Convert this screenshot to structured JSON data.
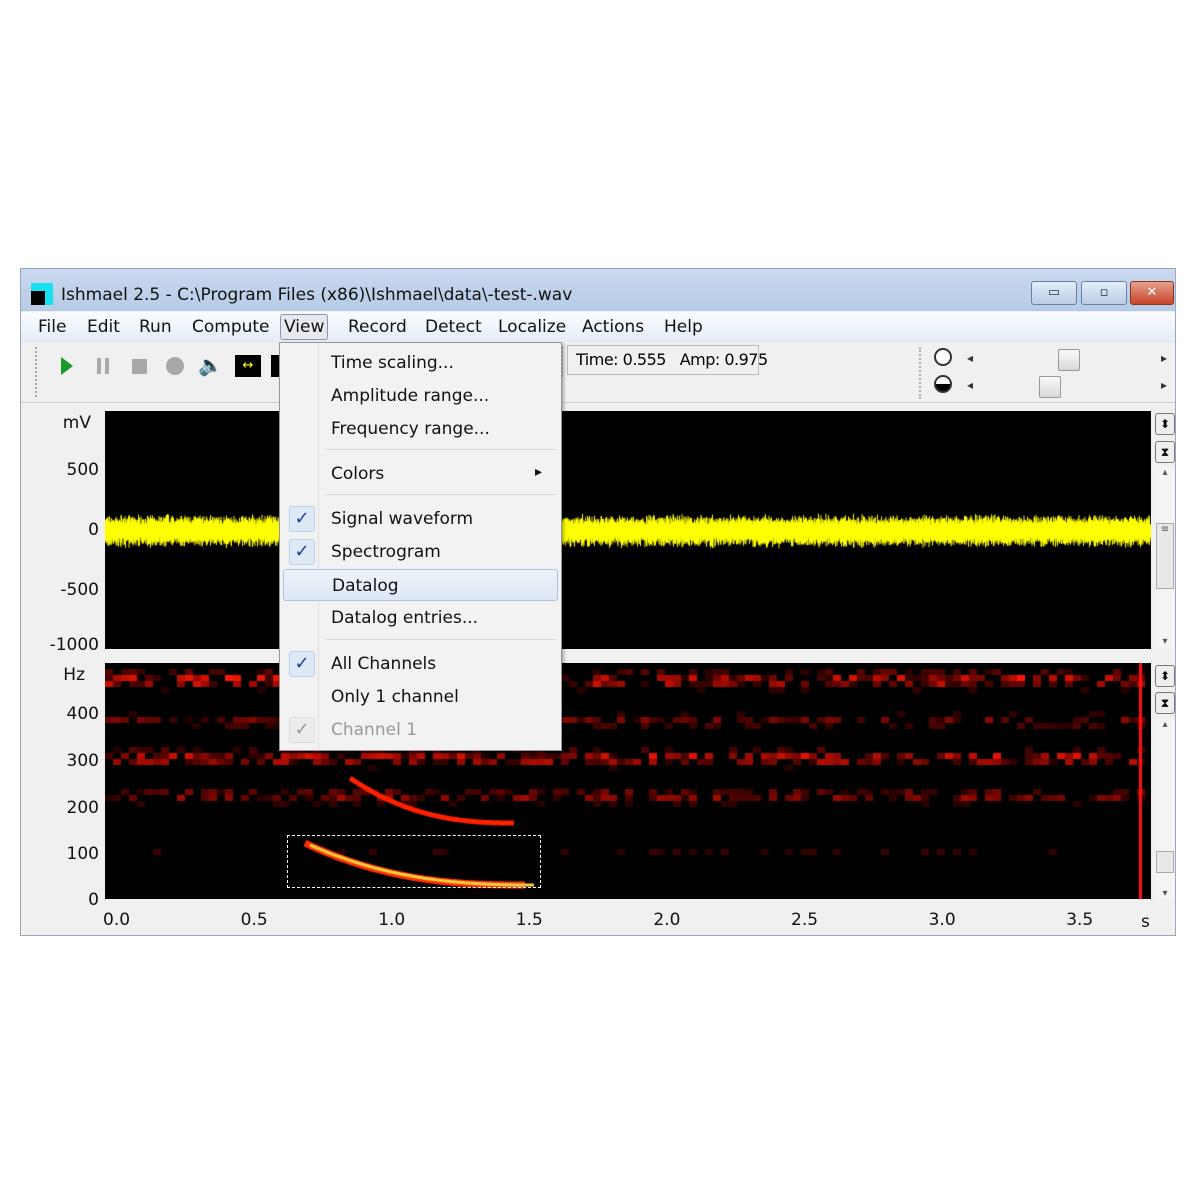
{
  "window": {
    "title": "Ishmael 2.5 - C:\\Program Files (x86)\\Ishmael\\data\\-test-.wav",
    "minimize": "▭",
    "maximize": "▫",
    "close": "✕"
  },
  "menubar": [
    "File",
    "Edit",
    "Run",
    "Compute",
    "View",
    "Record",
    "Detect",
    "Localize",
    "Actions",
    "Help"
  ],
  "toolbar": {
    "icons": [
      "play-icon",
      "pause-icon",
      "stop-icon",
      "record-icon",
      "speaker-icon",
      "zoom-horizontal-icon",
      "zoom-vertical-icon"
    ],
    "readout": "Time: 0.555   Amp: 0.975",
    "brightness_slider": 0.45,
    "contrast_slider": 0.34
  },
  "waveform": {
    "unit": "mV",
    "yticks": [
      "500",
      "0",
      "-500",
      "-1000"
    ],
    "color": "#ffff00"
  },
  "spectrogram": {
    "unit": "Hz",
    "yticks": [
      "400",
      "300",
      "200",
      "100",
      "0"
    ],
    "color": "#ff2000"
  },
  "xaxis": {
    "ticks": [
      "0.0",
      "0.5",
      "1.0",
      "1.5",
      "2.0",
      "2.5",
      "3.0",
      "3.5"
    ],
    "unit": "s"
  },
  "view_menu": {
    "items": [
      {
        "label": "Time scaling..."
      },
      {
        "label": "Amplitude range..."
      },
      {
        "label": "Frequency range..."
      },
      {
        "label": "Colors",
        "submenu": "▸"
      },
      {
        "label": "Signal waveform",
        "checked": "✓"
      },
      {
        "label": "Spectrogram",
        "checked": "✓"
      },
      {
        "label": "Datalog",
        "highlighted": true
      },
      {
        "label": "Datalog entries..."
      },
      {
        "label": "All Channels",
        "checked": "✓"
      },
      {
        "label": "Only 1 channel"
      },
      {
        "label": "Channel 1",
        "checked": "✓",
        "disabled": true
      }
    ]
  }
}
